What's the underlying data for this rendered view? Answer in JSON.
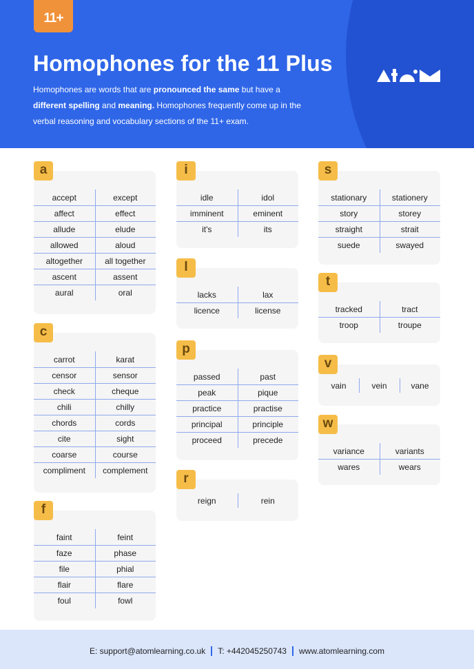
{
  "header": {
    "badge": "11+",
    "title": "Homophones for the 11 Plus",
    "intro": {
      "p1": "Homophones are words that are ",
      "b1": "pronounced the same",
      "p2": " but have a ",
      "b2": "different spelling",
      "p3": " and ",
      "b3": "meaning.",
      "p4": " Homophones frequently come up in the verbal reasoning and vocabulary sections of the 11+ exam."
    },
    "logo": "atom-logo",
    "colors": {
      "primary": "#2f66e8",
      "circle": "#2252d2",
      "badge": "#f0923a"
    }
  },
  "sections": {
    "a": {
      "letter": "a",
      "rows": [
        [
          "accept",
          "except"
        ],
        [
          "affect",
          "effect"
        ],
        [
          "allude",
          "elude"
        ],
        [
          "allowed",
          "aloud"
        ],
        [
          "altogether",
          "all together"
        ],
        [
          "ascent",
          "assent"
        ],
        [
          "aural",
          "oral"
        ]
      ]
    },
    "c": {
      "letter": "c",
      "rows": [
        [
          "carrot",
          "karat"
        ],
        [
          "censor",
          "sensor"
        ],
        [
          "check",
          "cheque"
        ],
        [
          "chili",
          "chilly"
        ],
        [
          "chords",
          "cords"
        ],
        [
          "cite",
          "sight"
        ],
        [
          "coarse",
          "course"
        ],
        [
          "compliment",
          "complement"
        ]
      ]
    },
    "f": {
      "letter": "f",
      "rows": [
        [
          "faint",
          "feint"
        ],
        [
          "faze",
          "phase"
        ],
        [
          "file",
          "phial"
        ],
        [
          "flair",
          "flare"
        ],
        [
          "foul",
          "fowl"
        ]
      ]
    },
    "i": {
      "letter": "i",
      "rows": [
        [
          "idle",
          "idol"
        ],
        [
          "imminent",
          "eminent"
        ],
        [
          "it's",
          "its"
        ]
      ]
    },
    "l": {
      "letter": "l",
      "rows": [
        [
          "lacks",
          "lax"
        ],
        [
          "licence",
          "license"
        ]
      ]
    },
    "p": {
      "letter": "p",
      "rows": [
        [
          "passed",
          "past"
        ],
        [
          "peak",
          "pique"
        ],
        [
          "practice",
          "practise"
        ],
        [
          "principal",
          "principle"
        ],
        [
          "proceed",
          "precede"
        ]
      ]
    },
    "r": {
      "letter": "r",
      "rows": [
        [
          "reign",
          "rein"
        ]
      ]
    },
    "s": {
      "letter": "s",
      "rows": [
        [
          "stationary",
          "stationery"
        ],
        [
          "story",
          "storey"
        ],
        [
          "straight",
          "strait"
        ],
        [
          "suede",
          "swayed"
        ]
      ]
    },
    "t": {
      "letter": "t",
      "rows": [
        [
          "tracked",
          "tract"
        ],
        [
          "troop",
          "troupe"
        ]
      ]
    },
    "v": {
      "letter": "v",
      "rows": [
        [
          "vain",
          "vein",
          "vane"
        ]
      ]
    },
    "w": {
      "letter": "w",
      "rows": [
        [
          "variance",
          "variants"
        ],
        [
          "wares",
          "wears"
        ]
      ]
    }
  },
  "footer": {
    "email": "E: support@atomlearning.co.uk",
    "phone": "T: +442045250743",
    "web": "www.atomlearning.com"
  }
}
